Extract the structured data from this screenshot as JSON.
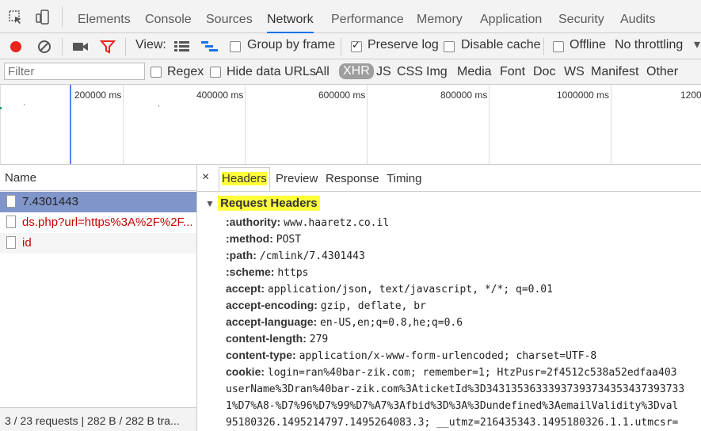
{
  "tabs": [
    "Elements",
    "Console",
    "Sources",
    "Network",
    "Performance",
    "Memory",
    "Application",
    "Security",
    "Audits"
  ],
  "active_tab": "Network",
  "toolbar": {
    "view_label": "View:",
    "group_by_frame": "Group by frame",
    "preserve_log": "Preserve log",
    "disable_cache": "Disable cache",
    "offline": "Offline",
    "throttling": "No throttling"
  },
  "filterbar": {
    "placeholder": "Filter",
    "regex": "Regex",
    "hide_data_urls": "Hide data URLs",
    "types": [
      "All",
      "XHR",
      "JS",
      "CSS",
      "Img",
      "Media",
      "Font",
      "Doc",
      "WS",
      "Manifest",
      "Other"
    ],
    "selected_type": "XHR"
  },
  "overview": {
    "ticks": [
      "200000 ms",
      "400000 ms",
      "600000 ms",
      "800000 ms",
      "1000000 ms",
      "1200"
    ]
  },
  "requests": {
    "header": "Name",
    "items": [
      {
        "name": "7.4301443"
      },
      {
        "name": "ds.php?url=https%3A%2F%2F..."
      },
      {
        "name": "id"
      }
    ],
    "status": "3 / 23 requests  |  282 B / 282 B tra..."
  },
  "detail": {
    "tabs": [
      "Headers",
      "Preview",
      "Response",
      "Timing"
    ],
    "close": "×",
    "section": "Request Headers",
    "headers": [
      {
        "name": ":authority:",
        "value": "www.haaretz.co.il"
      },
      {
        "name": ":method:",
        "value": "POST"
      },
      {
        "name": ":path:",
        "value": "/cmlink/7.4301443"
      },
      {
        "name": ":scheme:",
        "value": "https"
      },
      {
        "name": "accept:",
        "value": "application/json, text/javascript, */*; q=0.01"
      },
      {
        "name": "accept-encoding:",
        "value": "gzip, deflate, br"
      },
      {
        "name": "accept-language:",
        "value": "en-US,en;q=0.8,he;q=0.6"
      },
      {
        "name": "content-length:",
        "value": "279"
      },
      {
        "name": "content-type:",
        "value": "application/x-www-form-urlencoded; charset=UTF-8"
      },
      {
        "name": "cookie:",
        "value": "login=ran%40bar-zik.com; remember=1; HtzPusr=2f4512c538a52edfaa403"
      }
    ],
    "cookie_cont": [
      "userName%3Dran%40bar-zik.com%3AticketId%3D34313536333937393734353437393733",
      "1%D7%A8-%D7%96%D7%99%D7%A7%3Afbid%3D%3A%3Dundefined%3AemailValidity%3Dval",
      "95180326.1495214797.1495264083.3; __utmz=216435343.1495180326.1.1.utmcsr="
    ]
  }
}
